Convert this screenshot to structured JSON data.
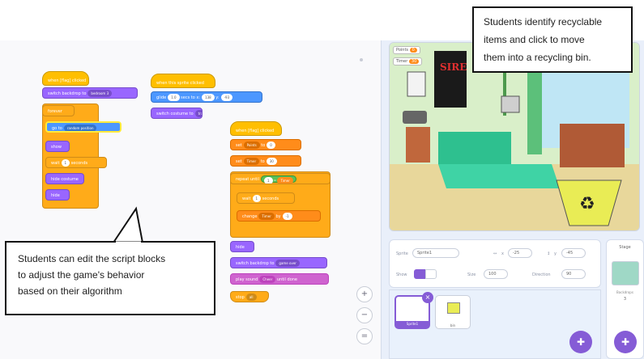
{
  "workspace": {
    "script1": {
      "hat": "when [flag] clicked",
      "look": "switch backdrop to",
      "look_value": "bedroom 3",
      "control": "forever",
      "motion": "go to",
      "motion_value": "random position",
      "show": "show",
      "wait": "wait",
      "wait_value": "1",
      "wait_unit": "seconds",
      "hide1": "hide costume",
      "hide2": "hide"
    },
    "script2": {
      "hat": "when this sprite clicked",
      "glide": "glide",
      "glide_v1": "1.0",
      "glide_mid": "secs to x:",
      "glide_v2": "138",
      "glide_y": "y:",
      "glide_v3": "-93",
      "end": "switch costume to",
      "end_v": "trash"
    },
    "script3": {
      "hat": "when [flag] clicked",
      "set1": "set",
      "set1_var": "Points",
      "set1_to": "to",
      "set1_val": "0",
      "set2": "set",
      "set2_var": "Timer",
      "set2_to": "to",
      "set2_val": "30",
      "repeat": "repeat until",
      "repeat_cond_a": "1",
      "repeat_cond_op": "=",
      "repeat_cond_b": "Timer",
      "wait": "wait",
      "wait_val": "1",
      "wait_unit": "seconds",
      "change": "change",
      "change_var": "Timer",
      "change_by": "by",
      "change_val": "-1",
      "after1": "hide",
      "after2": "switch backdrop to",
      "after2_v": "game over",
      "after3": "play sound",
      "after3_v": "Cheer",
      "after3_end": "until done",
      "after4": "stop",
      "after4_v": "all"
    },
    "zoom_in": "+",
    "zoom_out": "−",
    "zoom_reset": "="
  },
  "callouts": {
    "top": [
      "Students identify recyclable",
      "items and click to move",
      "them into a recycling bin."
    ],
    "bottom": [
      "Students can edit the script blocks",
      "to adjust the game's behavior",
      "based on their algorithm"
    ]
  },
  "stage": {
    "var1_label": "Points",
    "var1_value": "0",
    "var2_label": "Timer",
    "var2_value": "30",
    "poster_text": "SIRE",
    "recycle_symbol": "♻"
  },
  "sprite_info": {
    "sprite_label": "Sprite",
    "sprite_name": "Sprite1",
    "x_label": "x",
    "x_value": "-25",
    "y_label": "y",
    "y_value": "-45",
    "show_label": "Show",
    "size_label": "Size",
    "size_value": "100",
    "direction_label": "Direction",
    "direction_value": "90"
  },
  "sprites": [
    {
      "name": "Sprite1"
    },
    {
      "name": "bin"
    }
  ],
  "stage_panel": {
    "title": "Stage",
    "backdrops_label": "Backdrops",
    "backdrops_count": "3"
  },
  "colors": {
    "events": "#ffbf00",
    "looks": "#9966ff",
    "motion": "#4c97ff",
    "control": "#ffab19",
    "sound": "#cf63cf",
    "variables": "#ff8c1a",
    "operators": "#59c059",
    "accent": "#855cd6"
  }
}
